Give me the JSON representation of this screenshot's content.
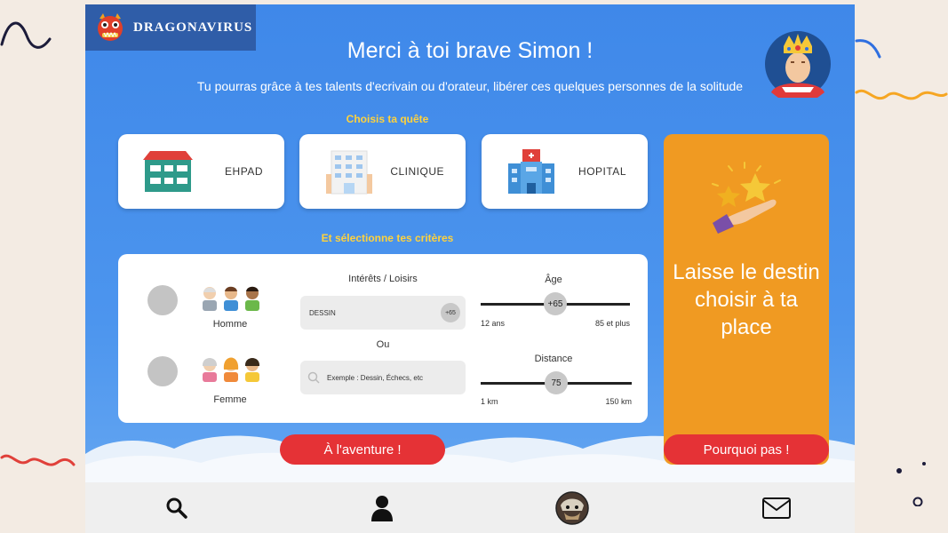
{
  "app": {
    "logo_text": "DRAGONAVIRUS",
    "title": "Merci à toi brave Simon !",
    "subtitle": "Tu pourras grâce à tes talents d'ecrivain ou d'orateur, libérer ces quelques personnes de la solitude"
  },
  "quest": {
    "label": "Choisis ta quête",
    "options": [
      {
        "label": "EHPAD",
        "icon": "nursing-home-icon"
      },
      {
        "label": "CLINIQUE",
        "icon": "clinic-icon"
      },
      {
        "label": "HOPITAL",
        "icon": "hospital-icon"
      }
    ]
  },
  "criteria": {
    "label": "Et sélectionne tes critères",
    "gender": {
      "male": "Homme",
      "female": "Femme"
    },
    "interests": {
      "label": "Intérêts / Loisirs",
      "selected": "DESSIN",
      "selected_badge": "+65",
      "or_label": "Ou",
      "search_placeholder": "Exemple : Dessin, Échecs, etc"
    },
    "age": {
      "label": "Âge",
      "value": "+65",
      "min_label": "12 ans",
      "max_label": "85 et plus",
      "fraction": 0.5
    },
    "distance": {
      "label": "Distance",
      "value": "75",
      "min_label": "1 km",
      "max_label": "150 km",
      "fraction": 0.5
    }
  },
  "destiny": {
    "text": "Laisse le destin choisir à ta place",
    "button": "Pourquoi pas !"
  },
  "actions": {
    "adventure": "À l'aventure !"
  },
  "nav": {
    "items": [
      "search-icon",
      "profile-icon",
      "avatar-icon",
      "mail-icon"
    ]
  },
  "colors": {
    "sky": "#4c95ee",
    "accent_orange": "#f09a22",
    "button_red": "#e53236",
    "label_yellow": "#ffd23c"
  }
}
